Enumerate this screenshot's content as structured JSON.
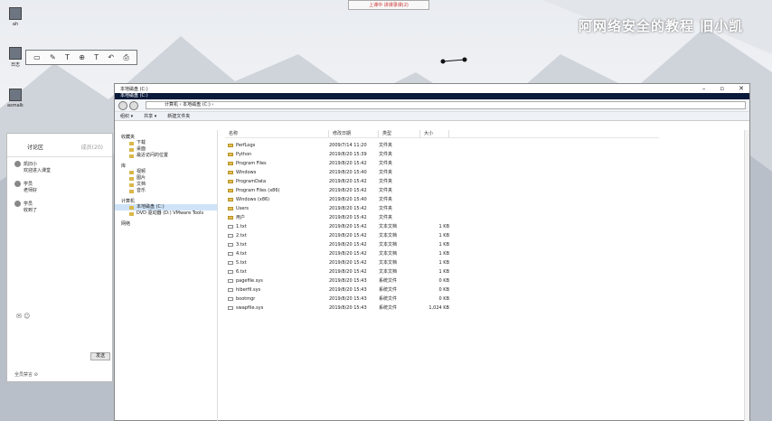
{
  "desktop": {
    "icons": [
      {
        "label": "ah"
      },
      {
        "label": "日志"
      },
      {
        "label": "asmalk"
      }
    ],
    "annotation_tools": [
      "▭",
      "✎",
      "T",
      "⊕",
      "T",
      "↶",
      "⎙"
    ],
    "banner": "上课中 讲课录课(2)",
    "watermark": "阿网络安全的教程 旧小凯"
  },
  "chat": {
    "tab_active": "讨论区",
    "tab_other": "成员(20)",
    "items": [
      {
        "name": "凯旧小",
        "msg": "欢迎进入课堂"
      },
      {
        "name": "学员",
        "msg": "老师好"
      },
      {
        "name": "学员",
        "msg": "收到了"
      }
    ],
    "send": "发送",
    "foot_left": "✉ ☺",
    "foot_right": "全员禁言 ⊘"
  },
  "explorer": {
    "title": "本地磁盘 (C:)",
    "subtitle": "本地磁盘 (C:)",
    "address": "计算机 › 本地磁盘 (C:) ›",
    "toolbar": [
      "组织 ▾",
      "共享 ▾",
      "新建文件夹"
    ],
    "nav": {
      "favorites": "收藏夹",
      "fav_items": [
        "下载",
        "桌面",
        "最近访问的位置"
      ],
      "libs": "库",
      "lib_items": [
        "视频",
        "图片",
        "文档",
        "音乐"
      ],
      "computer": "计算机",
      "comp_items": [
        "本地磁盘 (C:)",
        "DVD 驱动器 (D:) VMware Tools"
      ],
      "network": "网络"
    },
    "columns": [
      "名称",
      "修改日期",
      "类型",
      "大小"
    ],
    "files": [
      {
        "name": "PerfLogs",
        "date": "2009/7/14 11:20",
        "type": "文件夹",
        "size": "",
        "folder": true
      },
      {
        "name": "Python",
        "date": "2019/8/20 15:39",
        "type": "文件夹",
        "size": "",
        "folder": true
      },
      {
        "name": "Program Files",
        "date": "2019/8/20 15:42",
        "type": "文件夹",
        "size": "",
        "folder": true
      },
      {
        "name": "Windows",
        "date": "2019/8/20 15:40",
        "type": "文件夹",
        "size": "",
        "folder": true
      },
      {
        "name": "ProgramData",
        "date": "2019/8/20 15:42",
        "type": "文件夹",
        "size": "",
        "folder": true
      },
      {
        "name": "Program Files (x86)",
        "date": "2019/8/20 15:42",
        "type": "文件夹",
        "size": "",
        "folder": true
      },
      {
        "name": "Windows (x86)",
        "date": "2019/8/20 15:40",
        "type": "文件夹",
        "size": "",
        "folder": true
      },
      {
        "name": "Users",
        "date": "2019/8/20 15:42",
        "type": "文件夹",
        "size": "",
        "folder": true
      },
      {
        "name": "用户",
        "date": "2019/8/20 15:42",
        "type": "文件夹",
        "size": "",
        "folder": true
      },
      {
        "name": "1.txt",
        "date": "2019/8/20 15:42",
        "type": "文本文档",
        "size": "1 KB",
        "folder": false
      },
      {
        "name": "2.txt",
        "date": "2019/8/20 15:42",
        "type": "文本文档",
        "size": "1 KB",
        "folder": false
      },
      {
        "name": "3.txt",
        "date": "2019/8/20 15:42",
        "type": "文本文档",
        "size": "1 KB",
        "folder": false
      },
      {
        "name": "4.txt",
        "date": "2019/8/20 15:42",
        "type": "文本文档",
        "size": "1 KB",
        "folder": false
      },
      {
        "name": "5.txt",
        "date": "2019/8/20 15:42",
        "type": "文本文档",
        "size": "1 KB",
        "folder": false
      },
      {
        "name": "6.txt",
        "date": "2019/8/20 15:42",
        "type": "文本文档",
        "size": "1 KB",
        "folder": false
      },
      {
        "name": "pagefile.sys",
        "date": "2019/8/20 15:43",
        "type": "系统文件",
        "size": "0 KB",
        "folder": false
      },
      {
        "name": "hiberfil.sys",
        "date": "2019/8/20 15:43",
        "type": "系统文件",
        "size": "0 KB",
        "folder": false
      },
      {
        "name": "bootmgr",
        "date": "2019/8/20 15:43",
        "type": "系统文件",
        "size": "0 KB",
        "folder": false
      },
      {
        "name": "swapfile.sys",
        "date": "2019/8/20 15:43",
        "type": "系统文件",
        "size": "1,024 KB",
        "folder": false
      }
    ]
  }
}
